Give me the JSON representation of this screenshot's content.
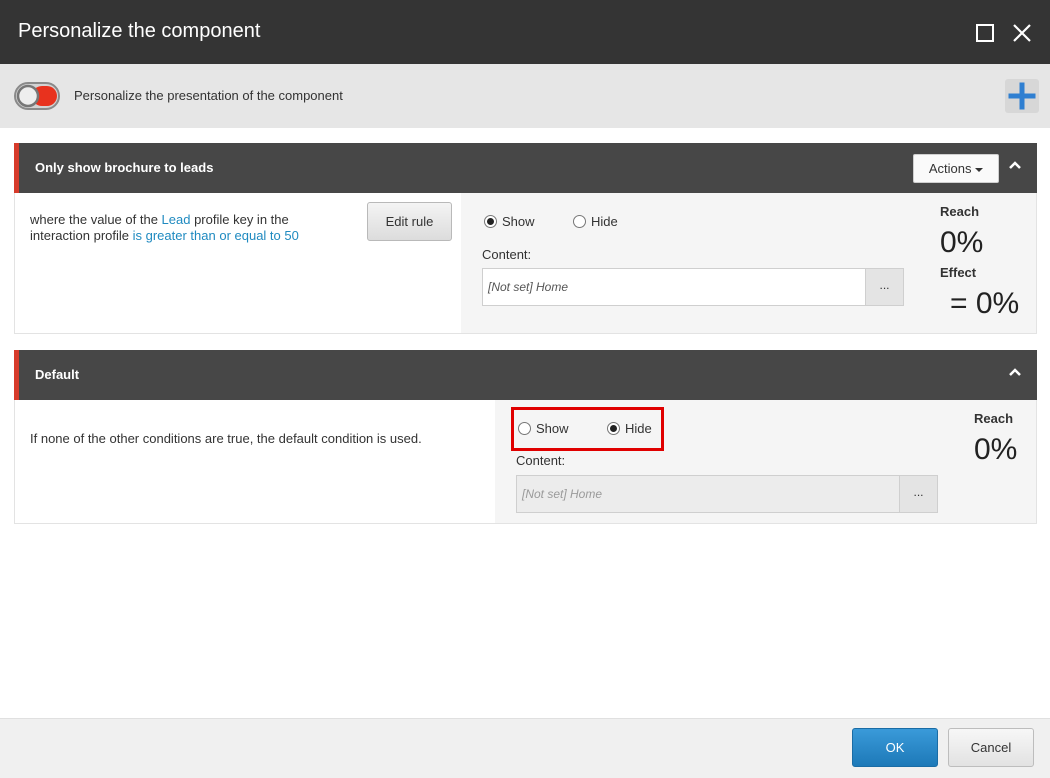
{
  "dialog": {
    "title": "Personalize the component"
  },
  "toggle_bar": {
    "label": "Personalize the presentation of the component",
    "add_icon": "plus-icon",
    "colors": {
      "accent": "#d63b2b",
      "add": "#2f7fd1"
    }
  },
  "rules": [
    {
      "name": "Only show brochure to leads",
      "actions_label": "Actions",
      "condition": {
        "prefix": "where the value of the ",
        "link1": "Lead",
        "middle": " profile key in the interaction profile ",
        "link2": "is greater than or equal to 50"
      },
      "edit_label": "Edit rule",
      "show_label": "Show",
      "hide_label": "Hide",
      "selected": "Show",
      "content_label": "Content:",
      "content_value": "[Not set] Home",
      "browse_label": "...",
      "reach_label": "Reach",
      "reach_value": "0%",
      "effect_label": "Effect",
      "effect_value": "= 0%"
    },
    {
      "name": "Default",
      "description": "If none of the other conditions are true, the default condition is used.",
      "show_label": "Show",
      "hide_label": "Hide",
      "selected": "Hide",
      "content_label": "Content:",
      "content_value": "[Not set] Home",
      "browse_label": "...",
      "reach_label": "Reach",
      "reach_value": "0%"
    }
  ],
  "footer": {
    "ok_label": "OK",
    "cancel_label": "Cancel"
  }
}
